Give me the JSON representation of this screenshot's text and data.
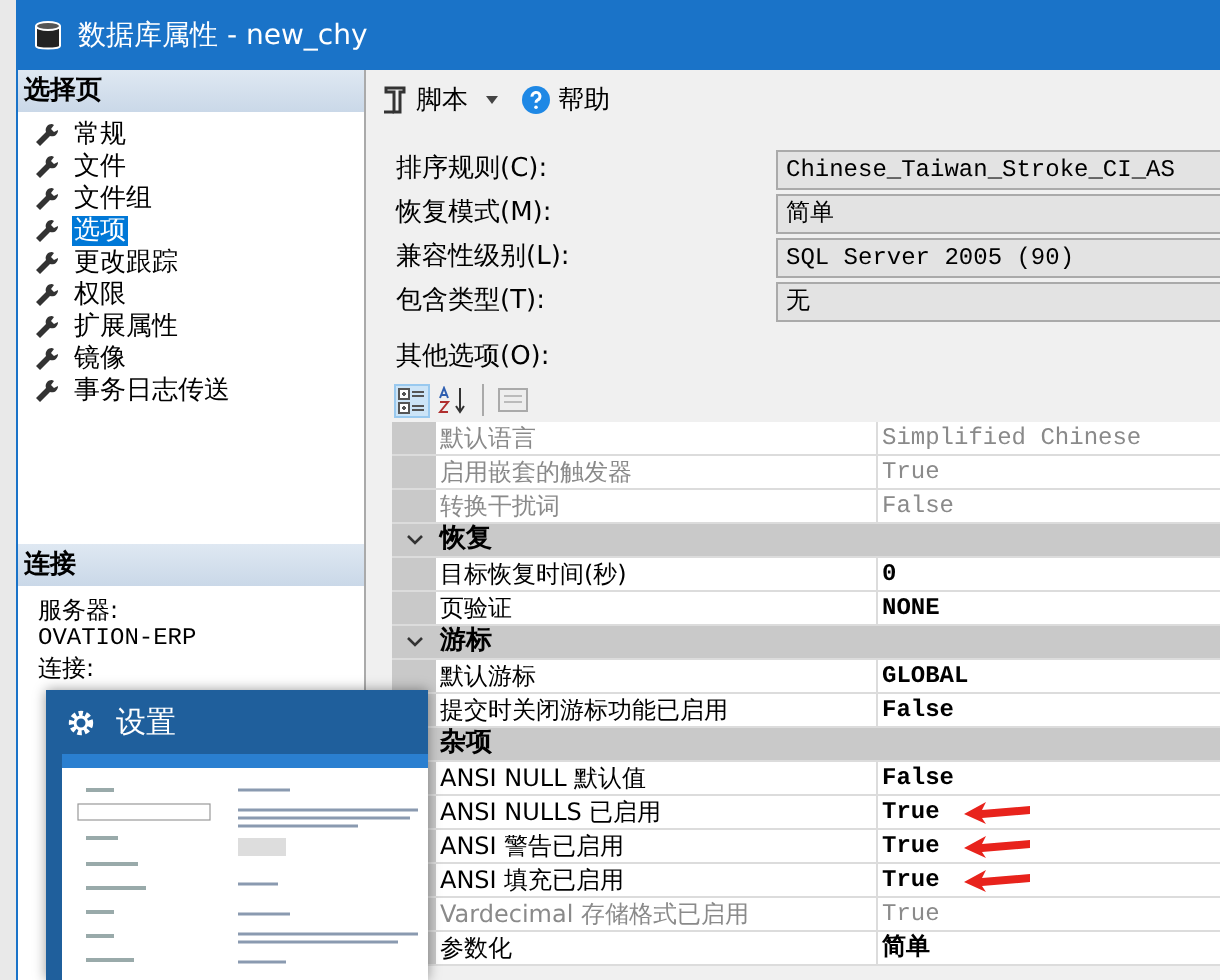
{
  "window": {
    "title": "数据库属性 - new_chy"
  },
  "sidebar": {
    "heading": "选择页",
    "items": [
      {
        "label": "常规",
        "selected": false
      },
      {
        "label": "文件",
        "selected": false
      },
      {
        "label": "文件组",
        "selected": false
      },
      {
        "label": "选项",
        "selected": true
      },
      {
        "label": "更改跟踪",
        "selected": false
      },
      {
        "label": "权限",
        "selected": false
      },
      {
        "label": "扩展属性",
        "selected": false
      },
      {
        "label": "镜像",
        "selected": false
      },
      {
        "label": "事务日志传送",
        "selected": false
      }
    ]
  },
  "connection": {
    "heading": "连接",
    "server_label": "服务器:",
    "server": "OVATION-ERP",
    "connection_label": "连接:"
  },
  "toolbar": {
    "script": "脚本",
    "help": "帮助"
  },
  "fields": [
    {
      "label": "排序规则(C):",
      "value": "Chinese_Taiwan_Stroke_CI_AS"
    },
    {
      "label": "恢复模式(M):",
      "value": "简单"
    },
    {
      "label": "兼容性级别(L):",
      "value": "SQL Server 2005 (90)"
    },
    {
      "label": "包含类型(T):",
      "value": "无"
    }
  ],
  "other_options_label": "其他选项(O):",
  "grid": [
    {
      "kind": "property",
      "name": "默认语言",
      "value": "Simplified Chinese",
      "disabled": true
    },
    {
      "kind": "property",
      "name": "启用嵌套的触发器",
      "value": "True",
      "disabled": true
    },
    {
      "kind": "property",
      "name": "转换干扰词",
      "value": "False",
      "disabled": true
    },
    {
      "kind": "category",
      "name": "恢复",
      "expanded": true
    },
    {
      "kind": "property",
      "name": "目标恢复时间(秒)",
      "value": "0",
      "disabled": false
    },
    {
      "kind": "property",
      "name": "页验证",
      "value": "NONE",
      "disabled": false
    },
    {
      "kind": "category",
      "name": "游标",
      "expanded": true
    },
    {
      "kind": "property",
      "name": "默认游标",
      "value": "GLOBAL",
      "disabled": false
    },
    {
      "kind": "property",
      "name": "提交时关闭游标功能已启用",
      "value": "False",
      "disabled": false
    },
    {
      "kind": "category",
      "name": "杂项"
    },
    {
      "kind": "property",
      "name": "ANSI NULL 默认值",
      "value": "False",
      "disabled": false
    },
    {
      "kind": "property",
      "name": "ANSI NULLS 已启用",
      "value": "True",
      "disabled": false,
      "annotated": true
    },
    {
      "kind": "property",
      "name": "ANSI 警告已启用",
      "value": "True",
      "disabled": false,
      "annotated": true
    },
    {
      "kind": "property",
      "name": "ANSI 填充已启用",
      "value": "True",
      "disabled": false,
      "annotated": true
    },
    {
      "kind": "property",
      "name": "Vardecimal 存储格式已启用",
      "value": "True",
      "disabled": true
    },
    {
      "kind": "property",
      "name": "参数化",
      "value": "简单",
      "disabled": false
    }
  ],
  "overlay_window": {
    "title": "设置"
  }
}
